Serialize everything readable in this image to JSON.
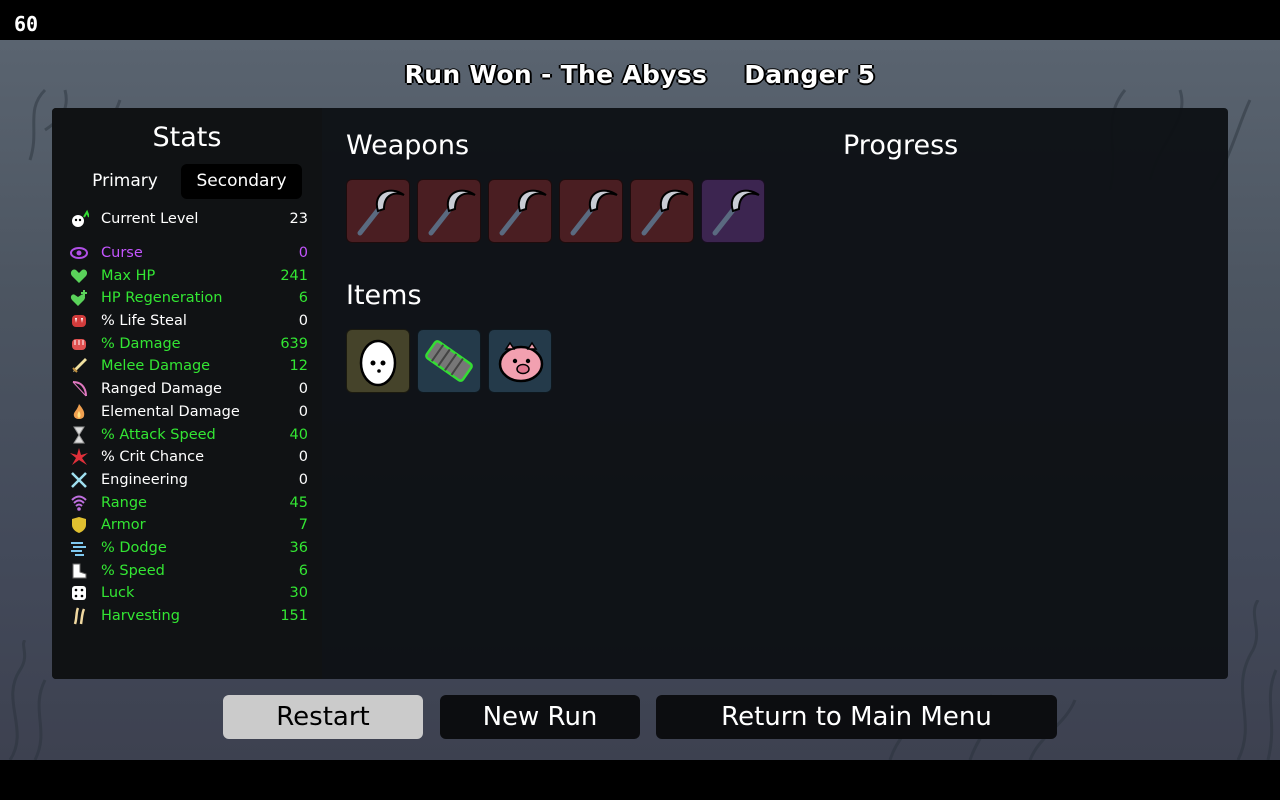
{
  "fps": "60",
  "header": {
    "run_status": "Run Won - The Abyss",
    "danger": "Danger 5"
  },
  "stats": {
    "title": "Stats",
    "tabs": [
      {
        "label": "Primary",
        "active": false
      },
      {
        "label": "Secondary",
        "active": true
      }
    ],
    "rows": [
      {
        "icon": "level-up-icon",
        "label": "Current Level",
        "value": "23",
        "color": "#ffffff"
      },
      {
        "icon": "curse-eye-icon",
        "label": "Curse",
        "value": "0",
        "color": "#c455ff"
      },
      {
        "icon": "heart-icon",
        "label": "Max HP",
        "value": "241",
        "color": "#33e633"
      },
      {
        "icon": "heart-plus-icon",
        "label": "HP Regeneration",
        "value": "6",
        "color": "#33e633"
      },
      {
        "icon": "fangs-icon",
        "label": "% Life Steal",
        "value": "0",
        "color": "#ffffff"
      },
      {
        "icon": "fist-icon",
        "label": "% Damage",
        "value": "639",
        "color": "#33e633"
      },
      {
        "icon": "sword-icon",
        "label": "Melee Damage",
        "value": "12",
        "color": "#33e633"
      },
      {
        "icon": "bow-icon",
        "label": "Ranged Damage",
        "value": "0",
        "color": "#ffffff"
      },
      {
        "icon": "flame-icon",
        "label": "Elemental Damage",
        "value": "0",
        "color": "#ffffff"
      },
      {
        "icon": "hourglass-icon",
        "label": "% Attack Speed",
        "value": "40",
        "color": "#33e633"
      },
      {
        "icon": "crit-burst-icon",
        "label": "% Crit Chance",
        "value": "0",
        "color": "#ffffff"
      },
      {
        "icon": "wrench-icon",
        "label": "Engineering",
        "value": "0",
        "color": "#ffffff"
      },
      {
        "icon": "range-signal-icon",
        "label": "Range",
        "value": "45",
        "color": "#33e633"
      },
      {
        "icon": "shield-icon",
        "label": "Armor",
        "value": "7",
        "color": "#33e633"
      },
      {
        "icon": "dodge-wind-icon",
        "label": "% Dodge",
        "value": "36",
        "color": "#33e633"
      },
      {
        "icon": "boot-icon",
        "label": "% Speed",
        "value": "6",
        "color": "#33e633"
      },
      {
        "icon": "dice-icon",
        "label": "Luck",
        "value": "30",
        "color": "#33e633"
      },
      {
        "icon": "wheat-icon",
        "label": "Harvesting",
        "value": "151",
        "color": "#33e633"
      }
    ]
  },
  "weapons": {
    "title": "Weapons",
    "slots": [
      {
        "icon": "scythe-icon",
        "tier": "red"
      },
      {
        "icon": "scythe-icon",
        "tier": "red"
      },
      {
        "icon": "scythe-icon",
        "tier": "red"
      },
      {
        "icon": "scythe-icon",
        "tier": "red"
      },
      {
        "icon": "scythe-icon",
        "tier": "red"
      },
      {
        "icon": "scythe-icon",
        "tier": "purple"
      }
    ]
  },
  "items": {
    "title": "Items",
    "slots": [
      {
        "icon": "egg-icon",
        "tier": "olive"
      },
      {
        "icon": "bandage-icon",
        "tier": "blue"
      },
      {
        "icon": "piggy-bank-icon",
        "tier": "blue"
      }
    ]
  },
  "progress": {
    "title": "Progress"
  },
  "buttons": {
    "restart": "Restart",
    "new_run": "New Run",
    "main_menu": "Return to Main Menu"
  }
}
